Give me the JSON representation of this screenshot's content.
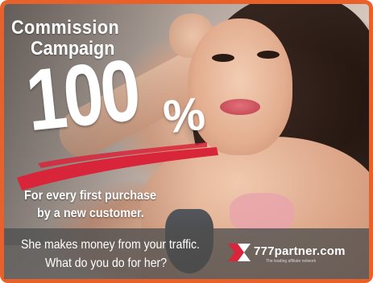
{
  "banner": {
    "heading_line1": "Commission",
    "heading_line2": "Campaign",
    "big_number": "100",
    "percent_sign": "%",
    "subline1": "For every first purchase",
    "subline2": "by a new customer.",
    "tagline1": "She makes money from your traffic.",
    "tagline2": "What do you do for her?"
  },
  "brand": {
    "name": "777partner.com",
    "tagline": "The leading affiliate network",
    "logo_icon": "777partner-logo-icon"
  },
  "colors": {
    "frame": "#e8612a",
    "swoosh": "#d8253a",
    "logo_red": "#d8253a",
    "text": "#ffffff",
    "bottom_bar": "#505050"
  }
}
